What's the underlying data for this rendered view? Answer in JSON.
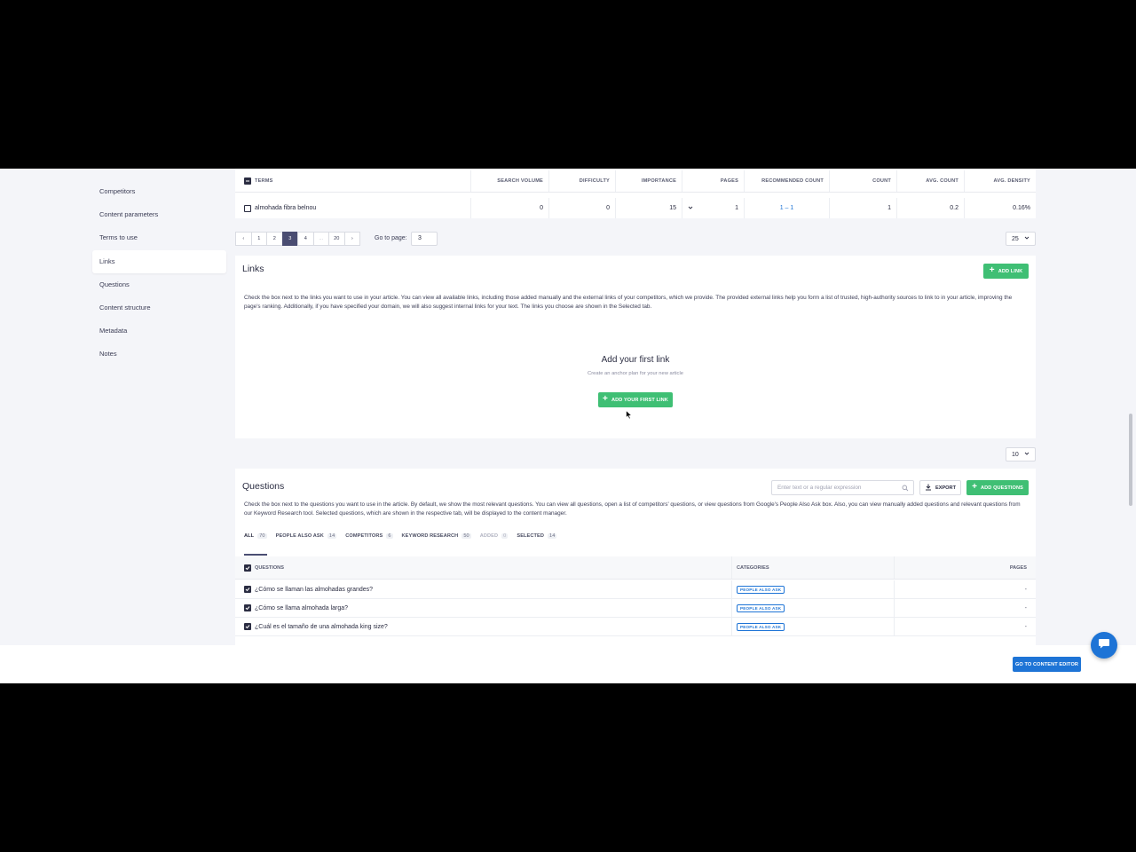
{
  "sidebar": {
    "items": [
      {
        "label": "Competitors"
      },
      {
        "label": "Content parameters"
      },
      {
        "label": "Terms to use"
      },
      {
        "label": "Links"
      },
      {
        "label": "Questions"
      },
      {
        "label": "Content structure"
      },
      {
        "label": "Metadata"
      },
      {
        "label": "Notes"
      }
    ],
    "active": "Links"
  },
  "terms_table": {
    "headers": [
      "TERMS",
      "SEARCH VOLUME",
      "DIFFICULTY",
      "IMPORTANCE",
      "PAGES",
      "RECOMMENDED COUNT",
      "COUNT",
      "AVG. COUNT",
      "AVG. DENSITY"
    ],
    "row": {
      "term": "almohada fibra belnou",
      "search_volume": "0",
      "difficulty": "0",
      "importance": "15",
      "pages": "1",
      "recommended_count": "1 – 1",
      "count": "1",
      "avg_count": "0.2",
      "avg_density": "0.16%"
    }
  },
  "pagination": {
    "prev": "‹",
    "pages": [
      "1",
      "2",
      "3",
      "4",
      "...",
      "20"
    ],
    "current": "3",
    "next": "›",
    "goto_label": "Go to page:",
    "goto_value": "3",
    "per_page": "25"
  },
  "links": {
    "title": "Links",
    "add_button": "ADD LINK",
    "description": "Check the box next to the links you want to use in your article. You can view all available links, including those added manually and the external links of your competitors, which we provide. The provided external links help you form a list of trusted, high-authority sources to link to in your article, improving the page's ranking. Additionally, if you have specified your domain, we will also suggest internal links for your text. The links you choose are shown in the Selected tab.",
    "empty_title": "Add your first link",
    "empty_subtitle": "Create an anchor plan for your new article",
    "empty_button": "ADD YOUR FIRST LINK",
    "per_page": "10"
  },
  "questions": {
    "title": "Questions",
    "search_placeholder": "Enter text or a regular expression",
    "export_button": "EXPORT",
    "add_button": "ADD QUESTIONS",
    "description": "Check the box next to the questions you want to use in the article. By default, we show the most relevant questions. You can view all questions, open a list of competitors' questions, or view questions from Google's People Also Ask box. Also, you can view manually added questions and relevant questions from our Keyword Research tool. Selected questions, which are shown in the respective tab, will be displayed to the content manager.",
    "tabs": [
      {
        "label": "ALL",
        "count": "70"
      },
      {
        "label": "PEOPLE ALSO ASK",
        "count": "14"
      },
      {
        "label": "COMPETITORS",
        "count": "6"
      },
      {
        "label": "KEYWORD RESEARCH",
        "count": "50"
      },
      {
        "label": "ADDED",
        "count": "0"
      },
      {
        "label": "SELECTED",
        "count": "14"
      }
    ],
    "columns": [
      "QUESTIONS",
      "CATEGORIES",
      "PAGES"
    ],
    "rows": [
      {
        "question": "¿Cómo se llaman las almohadas grandes?",
        "category": "PEOPLE ALSO ASK",
        "pages": "-"
      },
      {
        "question": "¿Cómo se llama almohada larga?",
        "category": "PEOPLE ALSO ASK",
        "pages": "-"
      },
      {
        "question": "¿Cuál es el tamaño de una almohada king size?",
        "category": "PEOPLE ALSO ASK",
        "pages": "-"
      }
    ]
  },
  "footer": {
    "go_to_editor": "GO TO CONTENT EDITOR"
  },
  "colors": {
    "accent_green": "#3fbf74",
    "accent_blue": "#1e74d6",
    "active_page": "#4a4d72"
  }
}
